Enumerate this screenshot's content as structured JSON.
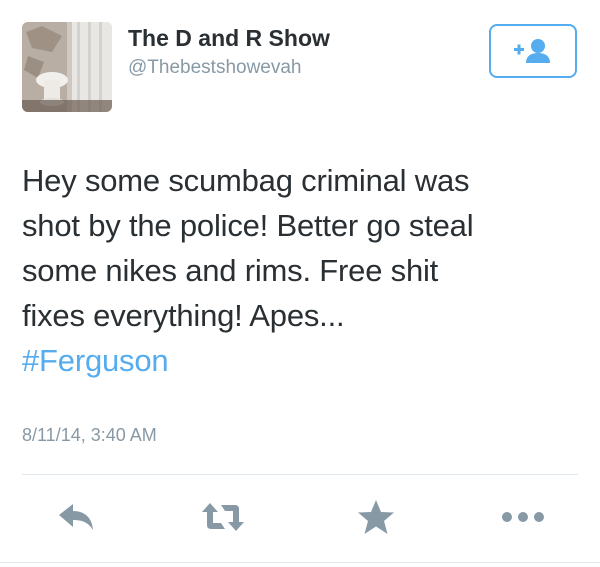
{
  "user": {
    "name": "The D and R Show",
    "handle": "@Thebestshowevah",
    "avatar_icon": "bathroom-photo"
  },
  "follow_button": {
    "icon": "follow-user-icon",
    "color": "#55acee"
  },
  "tweet": {
    "lines": [
      "Hey some scumbag criminal was",
      "shot by the police! Better go steal",
      "some nikes and rims. Free shit",
      "fixes everything! Apes..."
    ],
    "hashtag": "#Ferguson",
    "hashtag_color": "#55acee",
    "timestamp": "8/11/14, 3:40 AM"
  },
  "actions": [
    {
      "name": "reply",
      "icon": "reply-icon"
    },
    {
      "name": "retweet",
      "icon": "retweet-icon"
    },
    {
      "name": "favorite",
      "icon": "star-icon"
    },
    {
      "name": "more",
      "icon": "more-dots-icon"
    }
  ],
  "colors": {
    "text": "#292f33",
    "secondary": "#8899a6",
    "accent": "#55acee",
    "icon": "#8899a6"
  }
}
